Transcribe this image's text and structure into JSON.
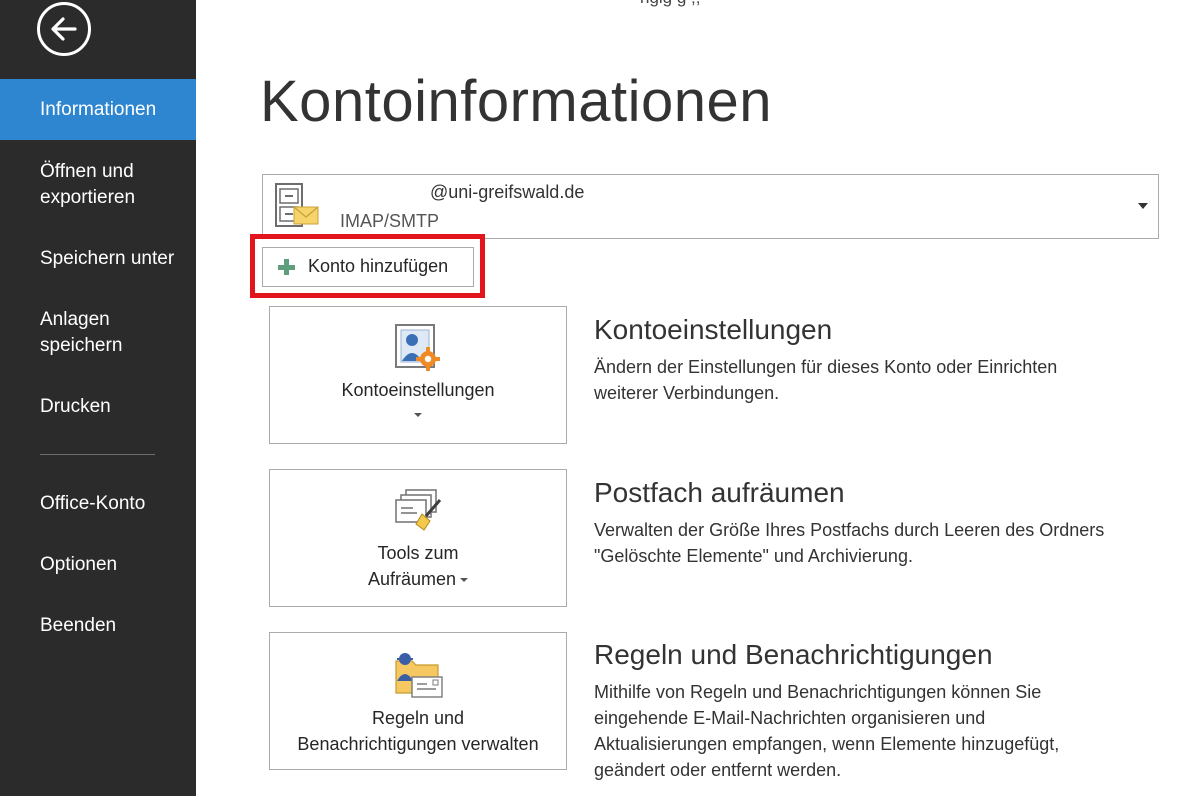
{
  "top_cut_text": "ngig                  g       ;;",
  "sidebar": {
    "back_icon": "back-arrow-icon",
    "items": [
      {
        "label_line1": "Informationen",
        "label_line2": "",
        "active": true
      },
      {
        "label_line1": "Öffnen und",
        "label_line2": "exportieren",
        "active": false
      },
      {
        "label_line1": "Speichern unter",
        "label_line2": "",
        "active": false
      },
      {
        "label_line1": "Anlagen",
        "label_line2": "speichern",
        "active": false
      },
      {
        "label_line1": "Drucken",
        "label_line2": "",
        "active": false
      },
      {
        "label_line1": "Office-Konto",
        "label_line2": "",
        "active": false
      },
      {
        "label_line1": "Optionen",
        "label_line2": "",
        "active": false
      },
      {
        "label_line1": "Beenden",
        "label_line2": "",
        "active": false
      }
    ]
  },
  "main": {
    "title": "Kontoinformationen",
    "account": {
      "email": "@uni-greifswald.de",
      "type": "IMAP/SMTP",
      "icon": "mail-account-icon"
    },
    "add_account_label": "Konto hinzufügen",
    "sections": [
      {
        "tile_label_line1": "Kontoeinstellungen",
        "tile_label_line2": "",
        "title": "Kontoeinstellungen",
        "desc_line1": "Ändern der Einstellungen für dieses Konto oder Einrichten",
        "desc_line2": "weiterer Verbindungen.",
        "desc_line3": "",
        "desc_line4": "",
        "icon": "account-settings-icon"
      },
      {
        "tile_label_line1": "Tools zum",
        "tile_label_line2": "Aufräumen",
        "title": "Postfach aufräumen",
        "desc_line1": "Verwalten der Größe Ihres Postfachs durch Leeren des Ordners",
        "desc_line2": "\"Gelöschte Elemente\" und Archivierung.",
        "desc_line3": "",
        "desc_line4": "",
        "icon": "cleanup-tools-icon"
      },
      {
        "tile_label_line1": "Regeln und",
        "tile_label_line2": "Benachrichtigungen verwalten",
        "title": "Regeln und Benachrichtigungen",
        "desc_line1": "Mithilfe von Regeln und Benachrichtigungen können Sie",
        "desc_line2": "eingehende E-Mail-Nachrichten organisieren und",
        "desc_line3": "Aktualisierungen empfangen, wenn Elemente hinzugefügt,",
        "desc_line4": "geändert oder entfernt werden.",
        "icon": "rules-alerts-icon"
      }
    ]
  },
  "colors": {
    "sidebar_bg": "#2b2b2b",
    "active_item": "#2e86d1",
    "highlight_border": "#e2151d"
  }
}
